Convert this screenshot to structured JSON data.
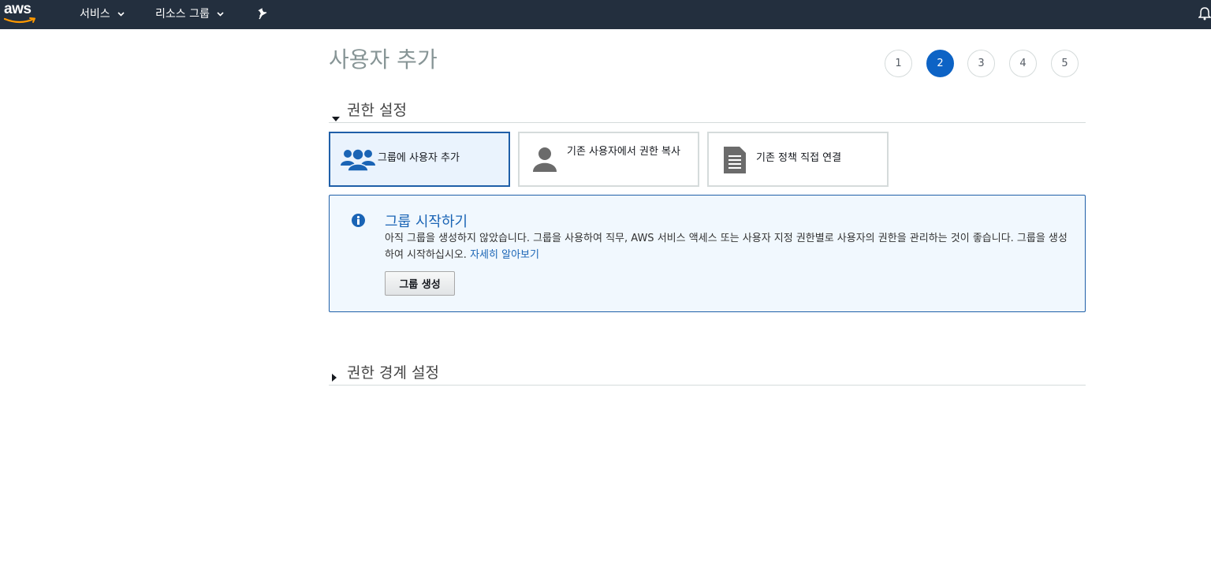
{
  "topnav": {
    "logo_text": "aws",
    "services_label": "서비스",
    "resource_groups_label": "리소스 그룹",
    "pin_icon": "pin-icon",
    "bell_icon": "bell-icon"
  },
  "page": {
    "title": "사용자 추가"
  },
  "steps": [
    {
      "label": "1",
      "active": false
    },
    {
      "label": "2",
      "active": true
    },
    {
      "label": "3",
      "active": false
    },
    {
      "label": "4",
      "active": false
    },
    {
      "label": "5",
      "active": false
    }
  ],
  "permissions_section": {
    "title": "권한 설정",
    "options": [
      {
        "label": "그룹에 사용자 추가",
        "icon": "group-icon",
        "selected": true
      },
      {
        "label": "기존 사용자에서 권한 복사",
        "icon": "user-icon",
        "selected": false
      },
      {
        "label": "기존 정책 직접 연결",
        "icon": "document-icon",
        "selected": false
      }
    ]
  },
  "info": {
    "icon": "info-icon",
    "title": "그룹 시작하기",
    "text": "아직 그룹을 생성하지 않았습니다. 그룹을 사용하여 직무, AWS 서비스 액세스 또는 사용자 지정 권한별로 사용자의 권한을 관리하는 것이 좋습니다. 그룹을 생성하여 시작하십시오.",
    "link": "자세히 알아보기",
    "button": "그룹 생성"
  },
  "boundary_section": {
    "title": "권한 경계 설정"
  },
  "colors": {
    "nav_bg": "#232f3e",
    "accent": "#0d63c5",
    "info_border": "#1f5fa8",
    "info_bg": "#f1f8fe"
  }
}
